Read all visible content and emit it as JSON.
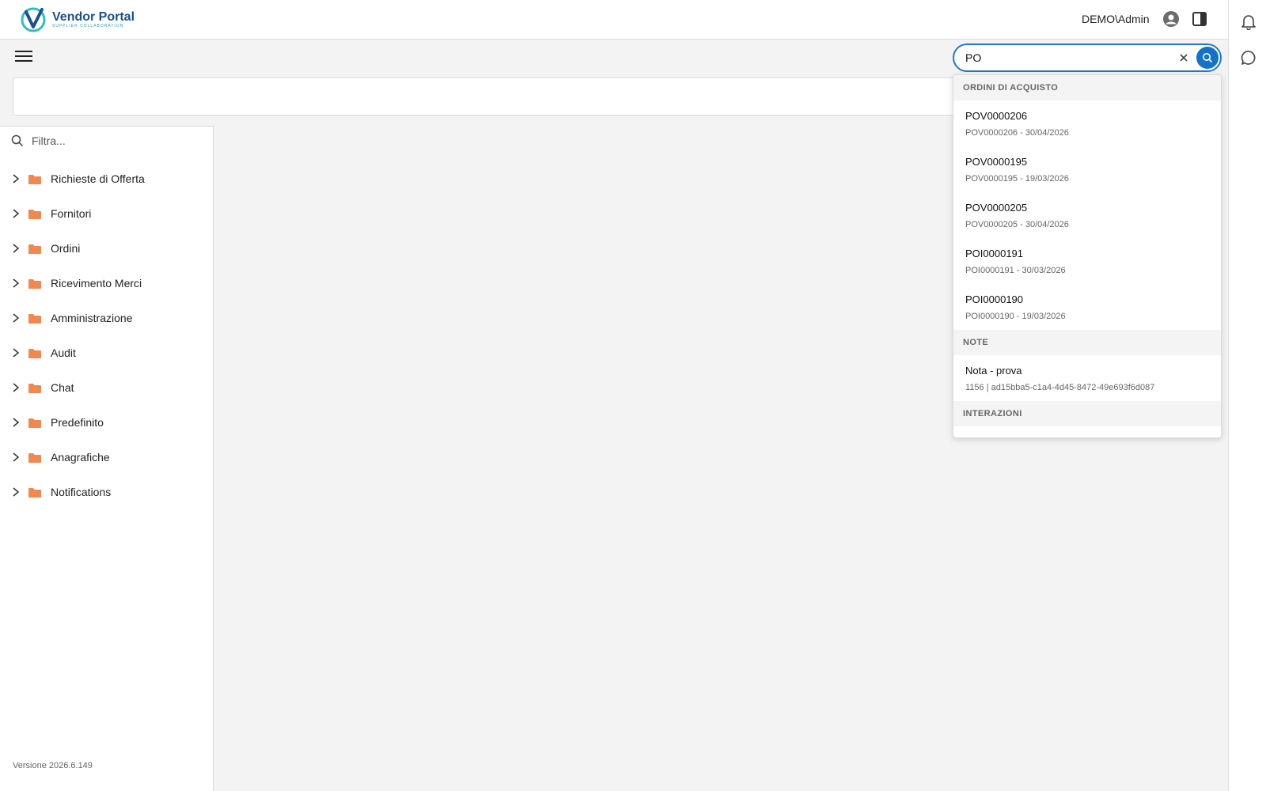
{
  "brand": {
    "title": "Vendor Portal",
    "subtitle": "SUPPLIER COLLABORATION"
  },
  "header": {
    "user": "DEMO\\Admin"
  },
  "colors": {
    "accent": "#1473c8",
    "folder": "#f0884f",
    "brand_dark": "#1d4f8f",
    "brand_light": "#2ac0c0"
  },
  "icons": {
    "menu": "hamburger-icon",
    "user": "user-circle-icon",
    "panel": "panel-toggle-icon",
    "bell": "bell-icon",
    "chat": "chat-icon",
    "search": "search-icon",
    "clear": "close-icon",
    "folder": "folder-icon",
    "chevron": "chevron-right-icon"
  },
  "sidebar": {
    "filter_placeholder": "Filtra...",
    "items": [
      {
        "label": "Richieste di Offerta"
      },
      {
        "label": "Fornitori"
      },
      {
        "label": "Ordini"
      },
      {
        "label": "Ricevimento Merci"
      },
      {
        "label": "Amministrazione"
      },
      {
        "label": "Audit"
      },
      {
        "label": "Chat"
      },
      {
        "label": "Predefinito"
      },
      {
        "label": "Anagrafiche"
      },
      {
        "label": "Notifications"
      }
    ],
    "version": "Versione 2026.6.149"
  },
  "search": {
    "value": "PO",
    "groups": [
      {
        "header": "ORDINI DI ACQUISTO",
        "results": [
          {
            "title": "POV0000206",
            "subtitle": "POV0000206 - 30/04/2026"
          },
          {
            "title": "POV0000195",
            "subtitle": "POV0000195 - 19/03/2026"
          },
          {
            "title": "POV0000205",
            "subtitle": "POV0000205 - 30/04/2026"
          },
          {
            "title": "POI0000191",
            "subtitle": "POI0000191 - 30/03/2026"
          },
          {
            "title": "POI0000190",
            "subtitle": "POI0000190 - 19/03/2026"
          }
        ]
      },
      {
        "header": "NOTE",
        "results": [
          {
            "title": "Nota - prova",
            "subtitle": "1156 | ad15bba5-c1a4-4d45-8472-49e693f6d087"
          }
        ]
      },
      {
        "header": "INTERAZIONI",
        "results": []
      }
    ]
  }
}
